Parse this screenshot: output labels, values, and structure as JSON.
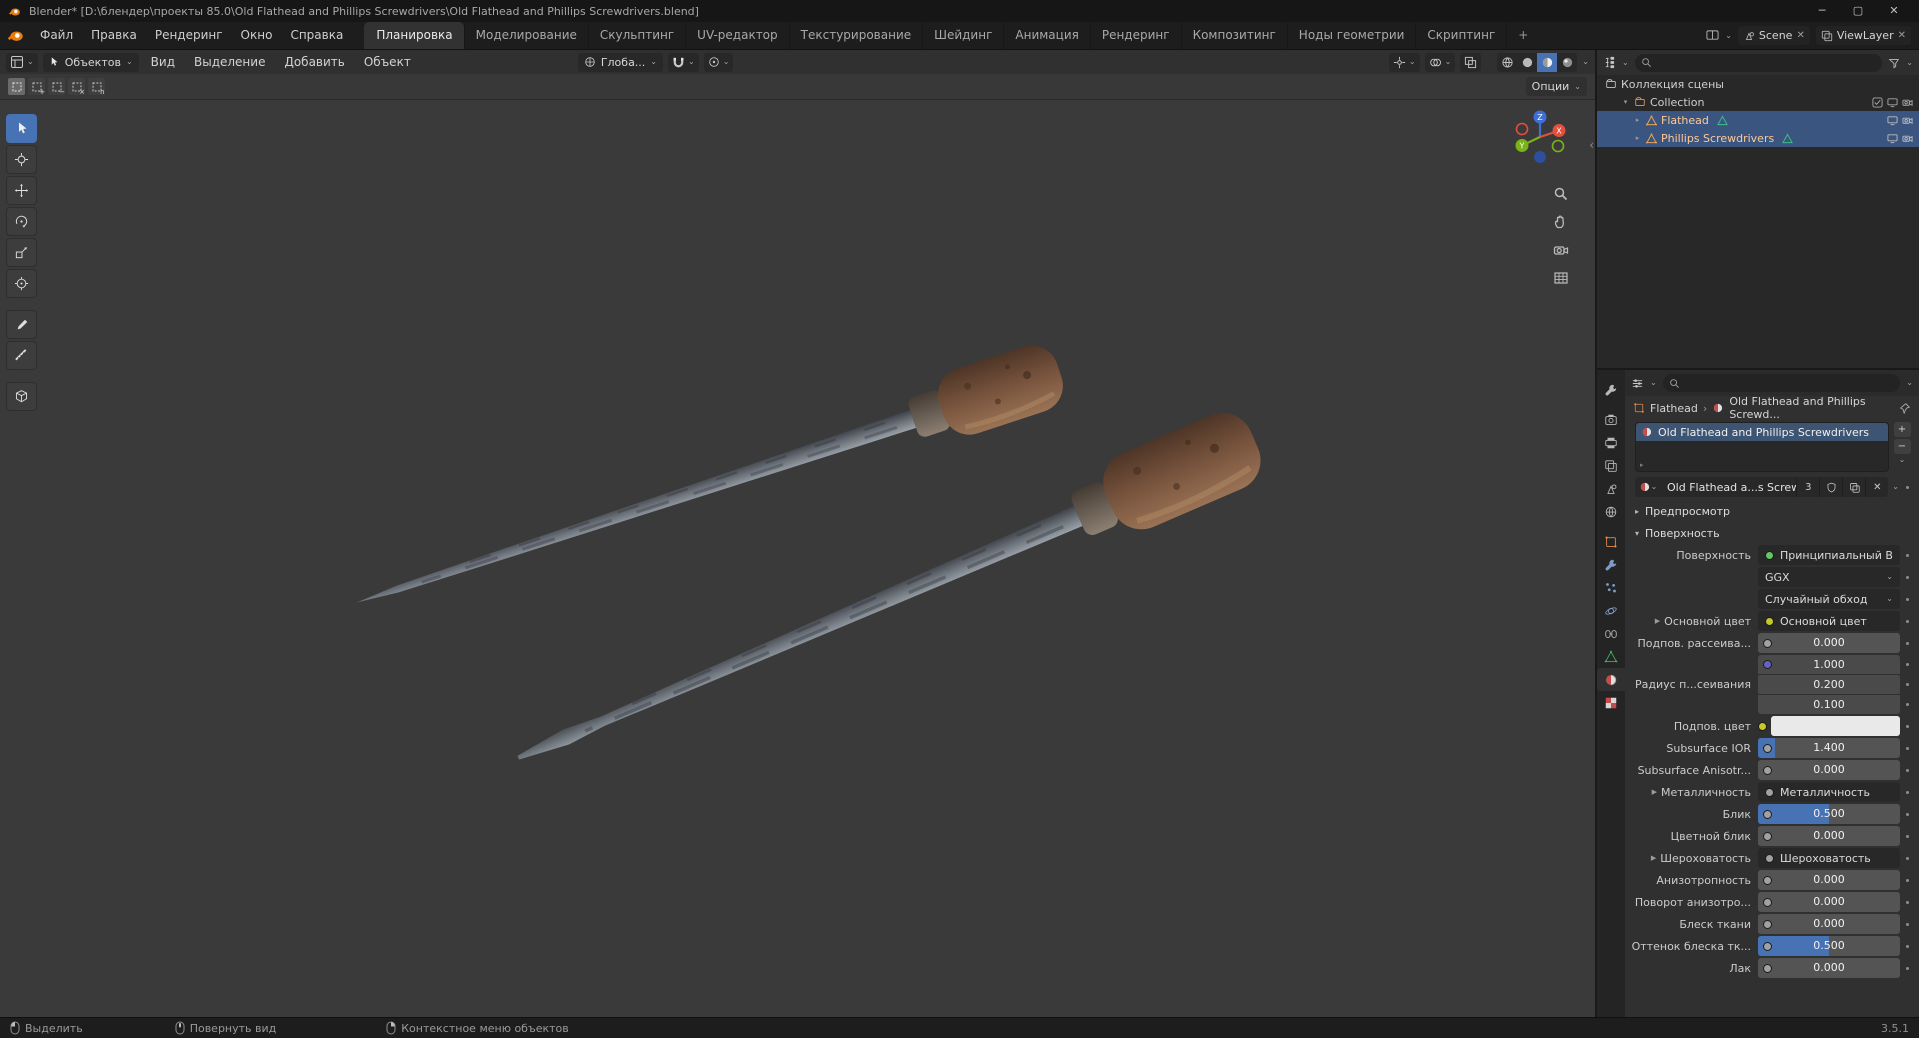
{
  "colors": {
    "accent": "#4772b3",
    "selection_row": "#3a5680",
    "axis_x": "#e24f3e",
    "axis_y": "#7ab317",
    "axis_z": "#3e6fd8",
    "socket_shader": "#63c763",
    "socket_color": "#c7c729",
    "socket_vector": "#6363c7",
    "socket_value": "#a1a1a1"
  },
  "titlebar": {
    "title": "Blender* [D:\\блендер\\проекты 85.0\\Old Flathead and Phillips Screwdrivers\\Old Flathead and Phillips Screwdrivers.blend]"
  },
  "topbar": {
    "menus": [
      "Файл",
      "Правка",
      "Рендеринг",
      "Окно",
      "Справка"
    ],
    "workspaces": [
      "Планировка",
      "Моделирование",
      "Скульптинг",
      "UV-редактор",
      "Текстурирование",
      "Шейдинг",
      "Анимация",
      "Рендеринг",
      "Композитинг",
      "Ноды геометрии",
      "Скриптинг"
    ],
    "add_tab": "+",
    "scene": "Scene",
    "viewlayer": "ViewLayer"
  },
  "viewport": {
    "mode": "Объектов",
    "menus": [
      "Вид",
      "Выделение",
      "Добавить",
      "Объект"
    ],
    "orientation": "Глоба...",
    "options": "Опции"
  },
  "outliner": {
    "root": "Коллекция сцены",
    "rows": [
      {
        "label": "Collection"
      },
      {
        "label": "Flathead"
      },
      {
        "label": "Phillips Screwdrivers"
      }
    ]
  },
  "properties": {
    "breadcrumb": {
      "object": "Flathead",
      "separator": "›",
      "material": "Old Flathead and Phillips Screwd..."
    },
    "slot_name": "Old Flathead and Phillips Screwdrivers",
    "material_name": "Old Flathead a...s Screwdrivers",
    "users": "3",
    "preview_section": "Предпросмотр",
    "surface_section": "Поверхность",
    "rows": [
      {
        "label": "Поверхность",
        "value": "Принципиальный BSDF"
      },
      {
        "label": "",
        "value": "GGX"
      },
      {
        "label": "",
        "value": "Случайный обход"
      },
      {
        "label": "Основной цвет",
        "value": "Основной цвет"
      },
      {
        "label": "Подпов. рассеива...",
        "value": "0.000",
        "fill": 0
      },
      {
        "label": "Радиус п...сеивания",
        "v0": "1.000",
        "v1": "0.200",
        "v2": "0.100"
      },
      {
        "label": "Подпов. цвет",
        "swatch": "#e9e9e9"
      },
      {
        "label": "Subsurface IOR",
        "value": "1.400",
        "fill": 0.12
      },
      {
        "label": "Subsurface Anisotr...",
        "value": "0.000",
        "fill": 0
      },
      {
        "label": "Металличность",
        "value": "Металличность"
      },
      {
        "label": "Блик",
        "value": "0.500",
        "fill": 0.5
      },
      {
        "label": "Цветной блик",
        "value": "0.000",
        "fill": 0
      },
      {
        "label": "Шероховатость",
        "value": "Шероховатость"
      },
      {
        "label": "Анизотропность",
        "value": "0.000",
        "fill": 0
      },
      {
        "label": "Поворот анизотро...",
        "value": "0.000",
        "fill": 0
      },
      {
        "label": "Блеск ткани",
        "value": "0.000",
        "fill": 0
      },
      {
        "label": "Оттенок блеска тк...",
        "value": "0.500",
        "fill": 0.5
      },
      {
        "label": "Лак",
        "value": "0.000",
        "fill": 0
      }
    ]
  },
  "statusbar": {
    "items": [
      {
        "label": "Выделить"
      },
      {
        "label": "Повернуть вид"
      },
      {
        "label": "Контекстное меню объектов"
      }
    ],
    "version": "3.5.1"
  }
}
